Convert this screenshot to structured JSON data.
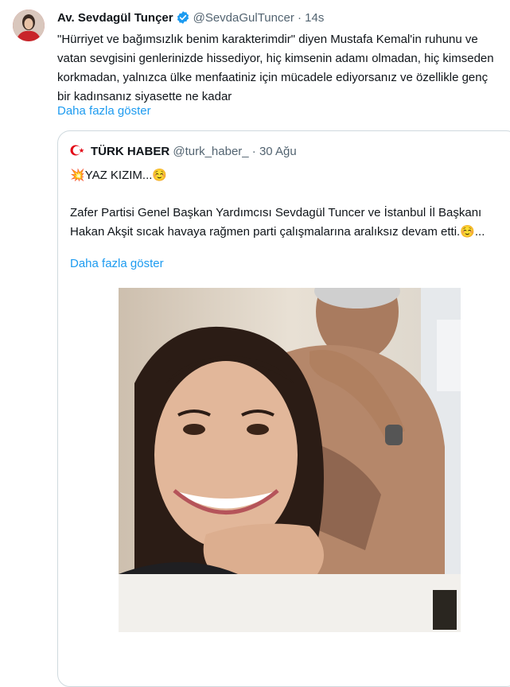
{
  "tweet": {
    "author_name": "Av. Sevdagül Tunçer",
    "handle": "@SevdaGulTuncer",
    "separator": "·",
    "time": "14s",
    "text": "\"Hürriyet ve bağımsızlık benim karakterimdir\" diyen Mustafa Kemal'in ruhunu ve vatan sevgisini genlerinizde hissediyor, hiç kimsenin adamı olmadan, hiç kimseden korkmadan, yalnızca ülke menfaatiniz için mücadele ediyorsanız ve özellikle genç bir kadınsanız siyasette ne kadar",
    "show_more": "Daha fazla göster"
  },
  "quote": {
    "author_name": "TÜRK HABER",
    "handle": "@turk_haber_",
    "separator": "·",
    "date": "30 Ağu",
    "emoji_prefix": "💥",
    "headline": "YAZ KIZIM...",
    "emoji_suffix": "☺️",
    "text": "Zafer Partisi Genel Başkan Yardımcısı Sevdagül Tuncer ve İstanbul İl Başkanı Hakan Akşit sıcak havaya rağmen parti çalışmalarına aralıksız devam etti.☺️...",
    "show_more": "Daha fazla göster"
  },
  "colors": {
    "link": "#1d9bf0",
    "muted": "#536471",
    "verified": "#1d9bf0",
    "border": "#cfd9de",
    "flag_red": "#e30a17"
  },
  "icons": {
    "verified": "verified-badge-icon",
    "flag": "crescent-star-icon"
  }
}
